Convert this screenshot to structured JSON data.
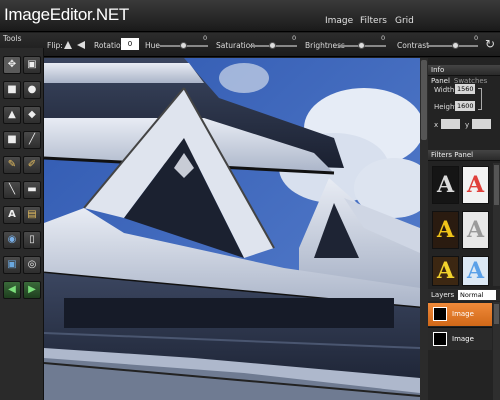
{
  "app": {
    "title": "ImageEditor.NET"
  },
  "menu": {
    "items": [
      "Image",
      "Filters",
      "Grid"
    ]
  },
  "options": {
    "flip_label": "Flip:",
    "rotation_label": "Rotation",
    "rotation_value": "0",
    "hue_label": "Hue",
    "hue_value": "0",
    "saturation_label": "Saturation",
    "saturation_value": "0",
    "brightness_label": "Brightness",
    "brightness_value": "0",
    "contrast_label": "Contrast",
    "contrast_value": "0"
  },
  "toolbox": {
    "label": "Tools",
    "tools": [
      "move-icon",
      "select-layer-icon",
      "rect-select-icon",
      "ellipse-select-icon",
      "triangle-shape-icon",
      "lasso-icon",
      "rectangle-shape-icon",
      "line-tool-icon",
      "pencil-icon",
      "brush-icon",
      "eyedropper-icon",
      "clone-stamp-icon",
      "text-icon",
      "note-icon",
      "water-drop-icon",
      "eraser-icon",
      "save-disk-icon",
      "location-pin-icon",
      "undo-icon",
      "redo-icon"
    ]
  },
  "info_panel": {
    "title": "Info Panel",
    "tab2": "Swatches",
    "width_label": "Width",
    "width_value": "1560",
    "height_label": "Height",
    "height_value": "1600",
    "x_label": "x",
    "y_label": "y",
    "x_value": "",
    "y_value": ""
  },
  "filters_panel": {
    "title": "Filters Panel",
    "thumbnails": [
      {
        "name": "filter-thumb-silver",
        "glyph": "A",
        "color": "#d9d9d9",
        "bg": "#151515"
      },
      {
        "name": "filter-thumb-red",
        "glyph": "A",
        "color": "#e0403b",
        "bg": "#f2f2f2"
      },
      {
        "name": "filter-thumb-gold",
        "glyph": "A",
        "color": "#f0c419",
        "bg": "#2a1b10"
      },
      {
        "name": "filter-thumb-chrome",
        "glyph": "A",
        "color": "#cfcfcf",
        "bg": "#e8e8e8"
      },
      {
        "name": "filter-thumb-yellow",
        "glyph": "A",
        "color": "#f2d22c",
        "bg": "#3c2712"
      },
      {
        "name": "filter-thumb-blue",
        "glyph": "A",
        "color": "#5aa0e8",
        "bg": "#dce8f4"
      }
    ]
  },
  "layers": {
    "title": "Layers",
    "blend_mode": "Normal",
    "items": [
      {
        "name": "Image",
        "active": true
      },
      {
        "name": "Image",
        "active": false
      }
    ]
  },
  "colors": {
    "accent": "#e87a2c",
    "panel": "#2a2a2a",
    "canvas_sky": "#3a61b5"
  }
}
